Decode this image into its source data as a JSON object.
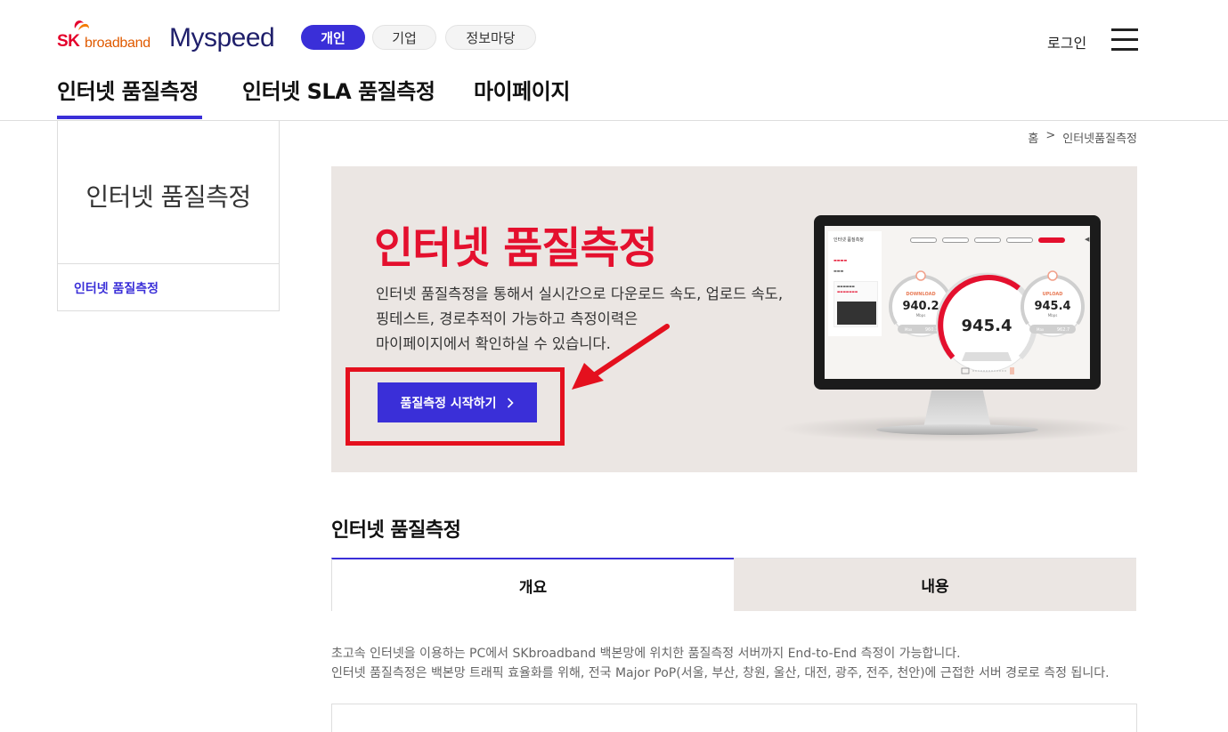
{
  "brand": {
    "sk": "SK",
    "broadband": "broadband",
    "product": "Myspeed"
  },
  "segments": [
    "개인",
    "기업",
    "정보마당"
  ],
  "header": {
    "login": "로그인"
  },
  "gnb": [
    "인터넷 품질측정",
    "인터넷 SLA 품질측정",
    "마이페이지"
  ],
  "sidebar": {
    "title": "인터넷 품질측정",
    "items": [
      {
        "label": "인터넷 품질측정"
      }
    ]
  },
  "breadcrumb": {
    "home": "홈",
    "separator": ">",
    "current": "인터넷품질측정"
  },
  "banner": {
    "title": "인터넷 품질측정",
    "desc_lines": [
      "인터넷 품질측정을 통해서 실시간으로 다운로드 속도, 업로드 속도,",
      "핑테스트, 경로추적이 가능하고 측정이력은",
      "마이페이지에서 확인하실 수 있습니다."
    ],
    "start_button": "품질측정 시작하기",
    "start_icon": "chevron-right-icon"
  },
  "monitor": {
    "download_label": "DOWNLOAD",
    "download_value": "940.2",
    "download_unit": "Mbps",
    "download_max": "960.1",
    "upload_label": "UPLOAD",
    "upload_value": "945.4",
    "upload_unit": "Mbps",
    "upload_max": "962.7",
    "center_value": "945.4",
    "max_label": "Max"
  },
  "section": {
    "title": "인터넷 품질측정",
    "tabs": [
      {
        "label": "개요",
        "active": true
      },
      {
        "label": "내용",
        "active": false
      }
    ],
    "intro_lines": [
      "초고속 인터넷을 이용하는 PC에서 SKbroadband 백본망에 위치한 품질측정 서버까지 End-to-End 측정이 가능합니다.",
      "인터넷 품질측정은 백본망 트래픽 효율화를 위해, 전국 Major PoP(서울, 부산, 창원, 울산, 대전, 광주, 전주, 천안)에 근접한 서버 경로로 측정 됩니다."
    ]
  },
  "colors": {
    "accent": "#3a2fd8",
    "brand_red": "#e4102e",
    "banner_bg": "#ebe6e3"
  }
}
